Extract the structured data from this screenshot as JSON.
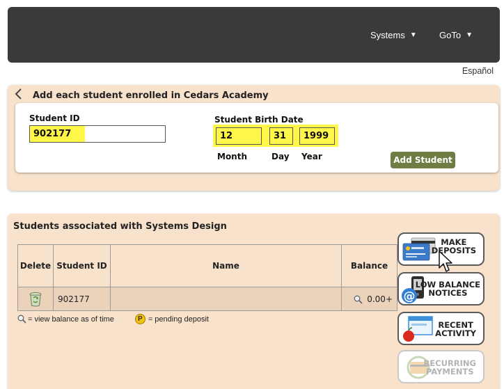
{
  "nav": {
    "systems_label": "Systems",
    "goto_label": "GoTo",
    "caret": "▼",
    "language_link": "Español"
  },
  "add_panel": {
    "back_icon": "chevron-left-icon",
    "title": "Add each student enrolled in Cedars Academy",
    "student_id_label": "Student ID",
    "student_id_value": "902177",
    "birth_date_label": "Student Birth Date",
    "month_value": "12",
    "day_value": "31",
    "year_value": "1999",
    "month_label": "Month",
    "day_label": "Day",
    "year_label": "Year",
    "add_button": "Add Student"
  },
  "assoc_panel": {
    "title": "Students associated with Systems Design",
    "columns": [
      "Delete",
      "Student ID",
      "Name",
      "Balance"
    ],
    "rows": [
      {
        "student_id": "902177",
        "name": "",
        "balance": "0.00+"
      }
    ],
    "legend_view": "= view balance as of time",
    "legend_pending_symbol": "P",
    "legend_pending": "= pending deposit"
  },
  "actions": {
    "make_deposits": [
      "MAKE",
      "DEPOSITS"
    ],
    "low_balance": [
      "LOW BALANCE",
      "NOTICES"
    ],
    "recent_activity": [
      "RECENT",
      "ACTIVITY"
    ],
    "recurring_payments": [
      "RECURRING",
      "PAYMENTS"
    ]
  },
  "colors": {
    "topbar": "#3a3a3a",
    "panel_bg": "#f8e2cc",
    "highlight": "#fff64a",
    "add_button": "#6e7d43"
  }
}
